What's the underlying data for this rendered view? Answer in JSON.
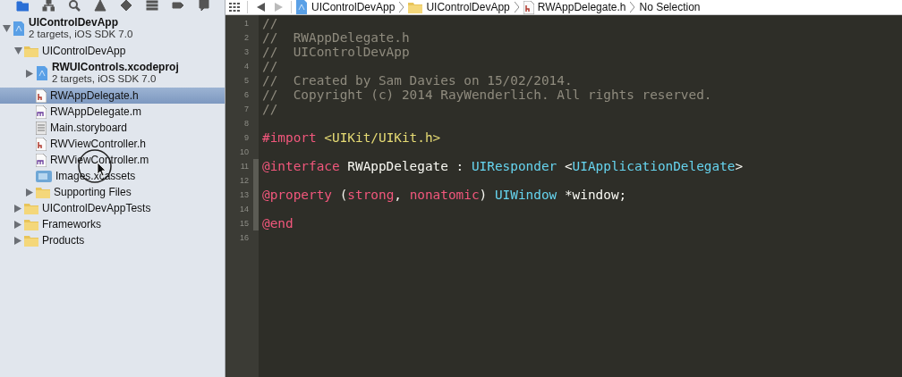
{
  "navigator_toolbar": [
    {
      "kind": "folder",
      "selected": true
    },
    {
      "kind": "hierarchy",
      "selected": false
    },
    {
      "kind": "search",
      "selected": false
    },
    {
      "kind": "warning",
      "selected": false
    },
    {
      "kind": "diamond",
      "selected": false
    },
    {
      "kind": "list",
      "selected": false
    },
    {
      "kind": "tag",
      "selected": false
    },
    {
      "kind": "bubble",
      "selected": false
    }
  ],
  "navigator": [
    {
      "kind": "project",
      "name": "UIControlDevApp",
      "subtitle": "2 targets, iOS SDK 7.0",
      "expanded": true,
      "selected": false,
      "children": [
        {
          "kind": "folder",
          "name": "UIControlDevApp",
          "expanded": true,
          "selected": false,
          "children": [
            {
              "kind": "subproject",
              "name": "RWUIControls.xcodeproj",
              "subtitle": "2 targets, iOS SDK 7.0",
              "expanded": false,
              "selected": false
            },
            {
              "kind": "header",
              "name": "RWAppDelegate.h",
              "selected": true
            },
            {
              "kind": "source",
              "name": "RWAppDelegate.m",
              "selected": false
            },
            {
              "kind": "storyboard",
              "name": "Main.storyboard",
              "selected": false
            },
            {
              "kind": "header",
              "name": "RWViewController.h",
              "selected": false
            },
            {
              "kind": "source",
              "name": "RWViewController.m",
              "selected": false
            },
            {
              "kind": "assets",
              "name": "Images.xcassets",
              "selected": false
            },
            {
              "kind": "folder",
              "name": "Supporting Files",
              "expanded": false,
              "selected": false
            }
          ]
        },
        {
          "kind": "folder",
          "name": "UIControlDevAppTests",
          "expanded": false,
          "selected": false
        },
        {
          "kind": "folder",
          "name": "Frameworks",
          "expanded": false,
          "selected": false
        },
        {
          "kind": "folder",
          "name": "Products",
          "expanded": false,
          "selected": false
        }
      ]
    }
  ],
  "jump_bar": {
    "forward_enabled": false,
    "path": [
      {
        "kind": "project",
        "label": "UIControlDevApp"
      },
      {
        "kind": "folder",
        "label": "UIControlDevApp"
      },
      {
        "kind": "header",
        "label": "RWAppDelegate.h"
      },
      {
        "kind": "none",
        "label": "No Selection"
      }
    ]
  },
  "editor": {
    "lines": [
      {
        "number": "1",
        "marked": false,
        "tokens": [
          {
            "kind": "comment",
            "text": "//"
          }
        ]
      },
      {
        "number": "2",
        "marked": false,
        "tokens": [
          {
            "kind": "comment",
            "text": "//  RWAppDelegate.h"
          }
        ]
      },
      {
        "number": "3",
        "marked": false,
        "tokens": [
          {
            "kind": "comment",
            "text": "//  UIControlDevApp"
          }
        ]
      },
      {
        "number": "4",
        "marked": false,
        "tokens": [
          {
            "kind": "comment",
            "text": "//"
          }
        ]
      },
      {
        "number": "5",
        "marked": false,
        "tokens": [
          {
            "kind": "comment",
            "text": "//  Created by Sam Davies on 15/02/2014."
          }
        ]
      },
      {
        "number": "6",
        "marked": false,
        "tokens": [
          {
            "kind": "comment",
            "text": "//  Copyright (c) 2014 RayWenderlich. All rights reserved."
          }
        ]
      },
      {
        "number": "7",
        "marked": false,
        "tokens": [
          {
            "kind": "comment",
            "text": "//"
          }
        ]
      },
      {
        "number": "8",
        "marked": false
      },
      {
        "number": "9",
        "marked": false,
        "tokens": [
          {
            "kind": "keyword",
            "text": "#import"
          },
          {
            "kind": "string",
            "text": " <UIKit/UIKit.h>"
          }
        ]
      },
      {
        "number": "10",
        "marked": false
      },
      {
        "number": "11",
        "marked": true,
        "tokens": [
          {
            "kind": "keyword",
            "text": "@interface"
          },
          {
            "kind": "plain",
            "text": " RWAppDelegate : "
          },
          {
            "kind": "type",
            "text": "UIResponder"
          },
          {
            "kind": "plain",
            "text": " <"
          },
          {
            "kind": "type",
            "text": "UIApplicationDelegate"
          },
          {
            "kind": "plain",
            "text": ">"
          }
        ]
      },
      {
        "number": "12",
        "marked": true
      },
      {
        "number": "13",
        "marked": true,
        "tokens": [
          {
            "kind": "keyword",
            "text": "@property"
          },
          {
            "kind": "plain",
            "text": " ("
          },
          {
            "kind": "keyword",
            "text": "strong"
          },
          {
            "kind": "plain",
            "text": ", "
          },
          {
            "kind": "keyword",
            "text": "nonatomic"
          },
          {
            "kind": "plain",
            "text": ") "
          },
          {
            "kind": "type",
            "text": "UIWindow"
          },
          {
            "kind": "plain",
            "text": " *window;"
          }
        ]
      },
      {
        "number": "14",
        "marked": true
      },
      {
        "number": "15",
        "marked": true,
        "tokens": [
          {
            "kind": "keyword",
            "text": "@end"
          }
        ]
      },
      {
        "number": "16",
        "marked": false
      }
    ]
  }
}
